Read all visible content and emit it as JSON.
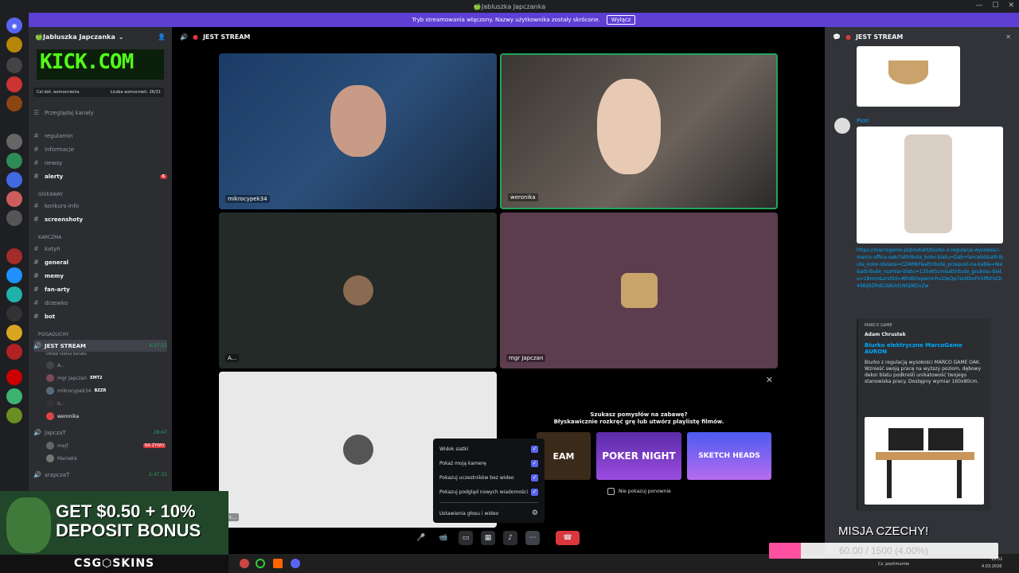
{
  "window": {
    "title": "🍏Jabluszka Japczanka",
    "controls": [
      "—",
      "☐",
      "✕"
    ]
  },
  "stream_bar": {
    "text": "Tryb streamowania włączony. Nazwy użytkownika zostały skrócone.",
    "button": "Wyłącz"
  },
  "server": {
    "name": "🍏Jabluszka Japczanka",
    "banner_text": "KICK.COM",
    "boost": {
      "left": "Cel dot. wzmocnienia",
      "right": "Liczba wzmocnień: 26/31"
    },
    "browse": "Przeglądaj kanały",
    "channels": [
      {
        "name": "regulamin",
        "bold": false
      },
      {
        "name": "informacje",
        "bold": false
      },
      {
        "name": "newsy",
        "bold": false
      },
      {
        "name": "alerty",
        "bold": true,
        "badge": "6"
      }
    ],
    "cat_giveaway": "GIVEAWAY",
    "giveaway_channels": [
      {
        "name": "konkurs-info",
        "bold": false
      },
      {
        "name": "screenshoty",
        "bold": true
      }
    ],
    "cat_karczma": "KARCZMA",
    "karczma_channels": [
      {
        "name": "katyń",
        "bold": false
      },
      {
        "name": "general",
        "bold": true
      },
      {
        "name": "memy",
        "bold": true
      },
      {
        "name": "fan-arty",
        "bold": true
      },
      {
        "name": "drzewko",
        "bold": false
      },
      {
        "name": "bot",
        "bold": true
      }
    ],
    "cat_pogaduchy": "POGADUCHY",
    "voice_channel": {
      "name": "JEST STREAM",
      "time": "4:27:21",
      "status": "Ustaw status kanału"
    },
    "voice_users": [
      "A...",
      "mgr Japczan",
      "mikrocypek34",
      "n...",
      "weronika"
    ],
    "voice_tags": {
      "mgr": "EMT2",
      "mikro": "BZZR"
    },
    "voice_channel2": {
      "name": "japczaT",
      "time": "28:47"
    },
    "voice_users2": [
      "mejf",
      "Maniekk"
    ],
    "live_badge": "NA ŻYWO",
    "voice_channel3": {
      "name": "srapczaT",
      "time": "2:47:31"
    }
  },
  "stage": {
    "title": "JEST STREAM",
    "tiles": [
      {
        "name": "mikrocypek34"
      },
      {
        "name": "weronika"
      },
      {
        "name": "A..."
      },
      {
        "name": "mgr Japczan"
      },
      {
        "name": "n..."
      }
    ],
    "activities": {
      "question": "Szukasz pomysłów na zabawę?",
      "subtitle": "Błyskawicznie rozkręć grę lub utwórz playlistę filmów.",
      "games": [
        "EAM",
        "POKER NIGHT",
        "SKETCH HEADS"
      ],
      "dont_show": "Nie pokazuj ponownie"
    },
    "popover": {
      "items": [
        "Widok siatki",
        "Pokaż moją kamerę",
        "Pokazuj uczestników bez wideo",
        "Pokazuj podgląd nowych wiadomości"
      ],
      "settings": "Ustawienia głosu i wideo"
    }
  },
  "chat": {
    "title": "JEST STREAM",
    "author": "Piotr",
    "link": "https://marcogame.pl/produkt/biurko-z-regulacja-wysokosci-marco-office-oak/?attribute_kolor-blatu=Dab+lancelot&attribute_kolor-stelaza=CZARNY&attribute_przepust-na-kable=Nie&attribute_rozmiar-blatu=135x65cm&attribute_grubosc-blatu=18mm&srsltid=AfmBOopwmnhu1lwQp7aUitbvFh5tfbFoCb498iJ9ZRdD3J6Ud1NGjlKOuZw",
    "embed": {
      "provider": "MARCO GAME",
      "author": "Adam Chrustek",
      "title": "Biurko elektryczne MarcoGame AURON",
      "description": "Biurko z regulacją wysokości MARCO GAME OAK. Wznieść swoją pracę na wyższy poziom, dębowy dekor blatu podkreśli unikatowość twojego stanowiska pracy. Dostępny wymiar 160x80cm."
    }
  },
  "overlay": {
    "ad_line1": "GET $0.50 + 10%",
    "ad_line2": "DEPOSIT BONUS",
    "ad_brand": "CSG⬡SKINS",
    "mission": "MISJA CZECHY!",
    "goal": "60.00 / 1500 (4.00%)",
    "goal_fraction": 0.04
  },
  "taskbar": {
    "weather": "Cz. pochmurnie",
    "time": "18:51",
    "date": "4.03.2026"
  },
  "colors": {
    "accent": "#5865f2",
    "stream_bar": "#5d3fd3",
    "kick": "#53fc18",
    "hangup": "#da373c",
    "goal": "#ff4fa0"
  }
}
